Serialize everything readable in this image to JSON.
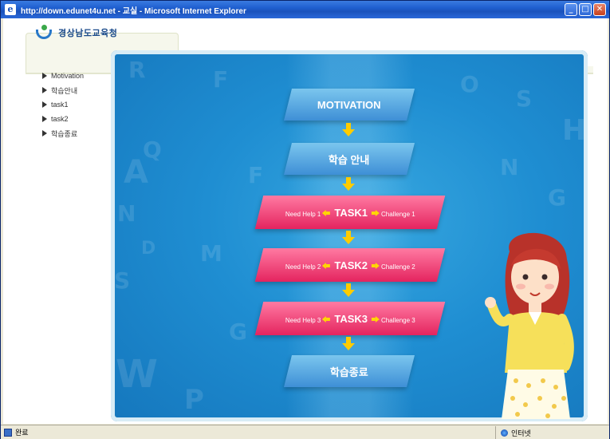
{
  "window": {
    "title": "http://down.edunet4u.net - 교실 - Microsoft Internet Explorer",
    "minimize_label": "_",
    "maximize_label": "□",
    "close_label": "✕"
  },
  "logo": {
    "text": "경상남도교육청"
  },
  "sidebar": {
    "items": [
      {
        "label": "Motivation"
      },
      {
        "label": "학습안내"
      },
      {
        "label": "task1"
      },
      {
        "label": "task2"
      },
      {
        "label": "학습종료"
      }
    ]
  },
  "flow": {
    "motivation": "MOTIVATION",
    "guide": "학습 안내",
    "tasks": [
      {
        "help": "Need Help 1",
        "task": "TASK1",
        "challenge": "Challenge 1"
      },
      {
        "help": "Need Help 2",
        "task": "TASK2",
        "challenge": "Challenge 2"
      },
      {
        "help": "Need Help 3",
        "task": "TASK3",
        "challenge": "Challenge 3"
      }
    ],
    "end": "학습종료"
  },
  "statusbar": {
    "text": "완료",
    "zone": "인터넷"
  },
  "colors": {
    "xp_title": "#1f5fd0",
    "stage_blue": "#1f8ed2",
    "task_pink": "#e4245f",
    "arrow_yellow": "#ffcc00"
  }
}
